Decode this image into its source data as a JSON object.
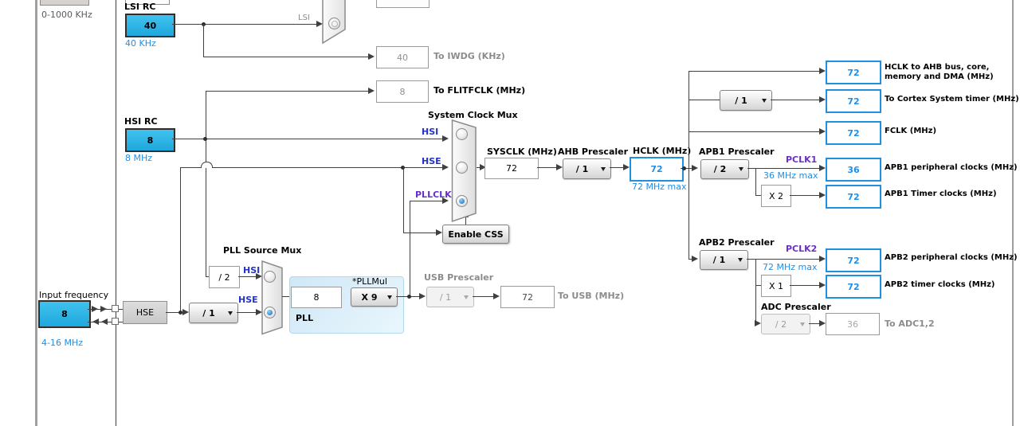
{
  "lsi": {
    "title": "LSI RC",
    "value": "40",
    "freq": "40 KHz",
    "line_label": "LSI",
    "iwdg_value": "40",
    "iwdg_label": "To IWDG (KHz)"
  },
  "hsi": {
    "title": "HSI RC",
    "value": "8",
    "freq": "8 MHz",
    "flitf_value": "8",
    "flitf_label": "To FLITFCLK (MHz)"
  },
  "lse": {
    "range_label": "0-1000 KHz"
  },
  "hse": {
    "input_title": "Input frequency",
    "input_value": "8",
    "input_range": "4-16 MHz",
    "osc_label": "HSE",
    "prescaler_value": "/ 1"
  },
  "pll": {
    "mux_title": "PLL Source Mux",
    "hsi_label": "HSI",
    "hse_label": "HSE",
    "div2_value": "/ 2",
    "src_value": "8",
    "mul_label": "*PLLMul",
    "mul_value": "X 9",
    "title": "PLL"
  },
  "sysmux": {
    "title": "System Clock Mux",
    "hsi_label": "HSI",
    "hse_label": "HSE",
    "pllclk_label": "PLLCLK",
    "css_button": "Enable CSS"
  },
  "sysclk": {
    "label": "SYSCLK (MHz)",
    "value": "72"
  },
  "ahb": {
    "label": "AHB Prescaler",
    "value": "/ 1"
  },
  "hclk": {
    "label": "HCLK (MHz)",
    "value": "72",
    "max": "72 MHz max"
  },
  "right": {
    "ahb_bus": {
      "value": "72",
      "label1": "HCLK to AHB bus, core,",
      "label2": "memory and DMA (MHz)"
    },
    "cortex": {
      "prescaler": "/ 1",
      "value": "72",
      "label": "To Cortex System timer (MHz)"
    },
    "fclk": {
      "value": "72",
      "label": "FCLK (MHz)"
    }
  },
  "apb1": {
    "prescaler_label": "APB1 Prescaler",
    "prescaler": "/ 2",
    "pclk": "PCLK1",
    "max": "36 MHz max",
    "periph_value": "36",
    "periph_label": "APB1 peripheral clocks (MHz)",
    "mult": "X 2",
    "timer_value": "72",
    "timer_label": "APB1 Timer clocks (MHz)"
  },
  "apb2": {
    "prescaler_label": "APB2 Prescaler",
    "prescaler": "/ 1",
    "pclk": "PCLK2",
    "max": "72 MHz max",
    "periph_value": "72",
    "periph_label": "APB2 peripheral clocks (MHz)",
    "mult": "X 1",
    "timer_value": "72",
    "timer_label": "APB2 timer clocks (MHz)"
  },
  "adc": {
    "prescaler_label": "ADC Prescaler",
    "prescaler": "/ 2",
    "value": "36",
    "label": "To ADC1,2"
  },
  "usb": {
    "prescaler_label": "USB Prescaler",
    "prescaler": "/ 1",
    "value": "72",
    "label": "To USB (MHz)"
  },
  "colors": {
    "accent_blue_border": "#1f8fe0",
    "cyan_fill": "#2ab5e8",
    "annotation_blue": "#1e8ee8",
    "signal_navy": "#2433cc",
    "signal_purple": "#6a2fc4"
  }
}
